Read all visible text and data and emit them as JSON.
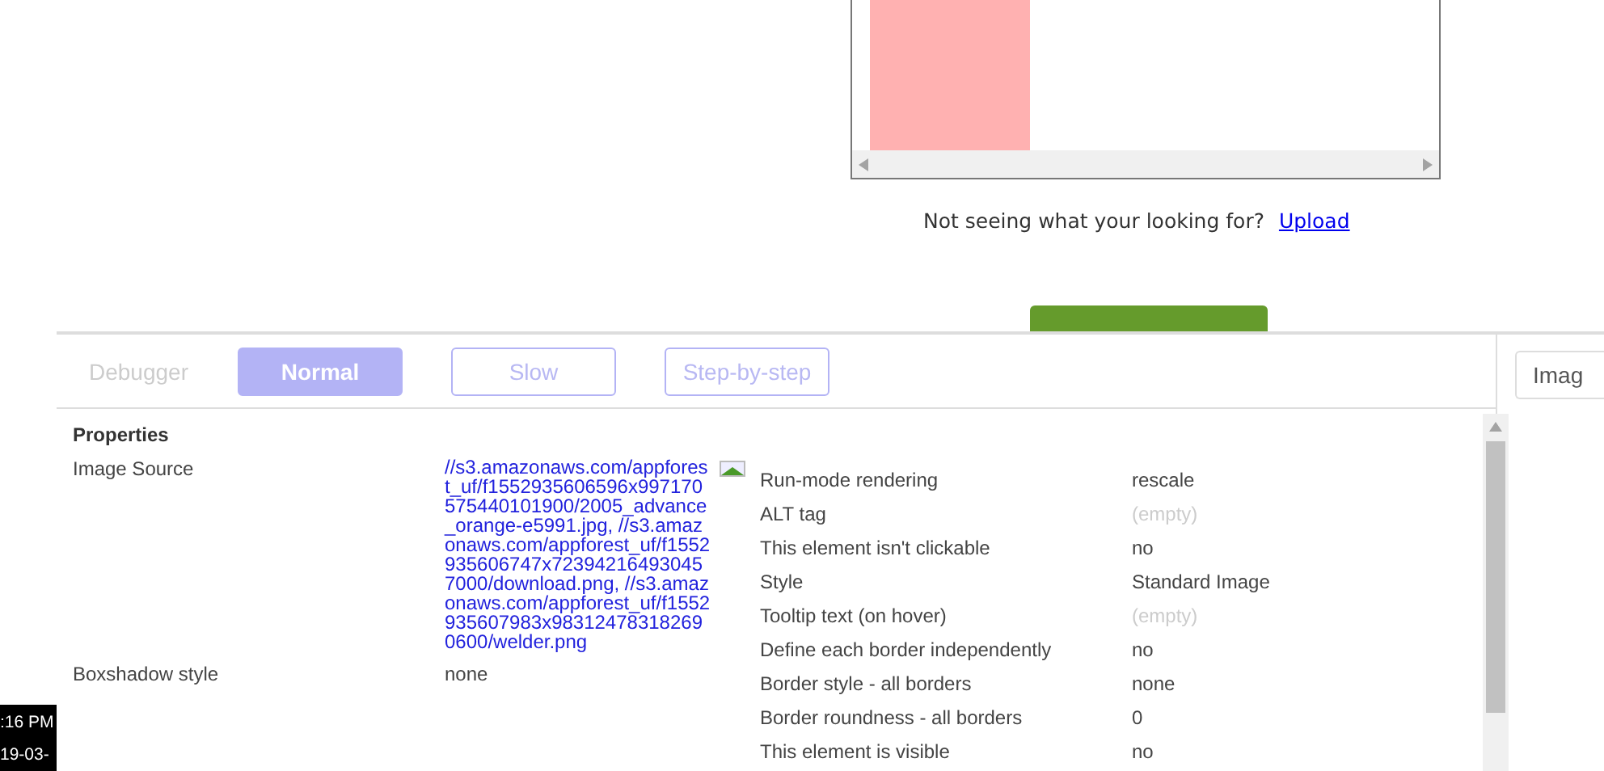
{
  "preview": {
    "prompt": "Not seeing what your looking for?",
    "upload_link": "Upload"
  },
  "toolbar": {
    "label": "Debugger",
    "modes": [
      {
        "label": "Normal",
        "selected": true
      },
      {
        "label": "Slow",
        "selected": false
      },
      {
        "label": "Step-by-step",
        "selected": false
      }
    ]
  },
  "side_panel": {
    "field_value": "Imag"
  },
  "properties": {
    "title": "Properties",
    "left": [
      {
        "label": "Image Source",
        "kind": "link",
        "value": "//s3.amazonaws.com/appforest_uf/f1552935606596x997170575440101900/2005_advance_orange-e5991.jpg, //s3.amazonaws.com/appforest_uf/f1552935606747x723942164930457000/download.png, //s3.amazonaws.com/appforest_uf/f1552935607983x983124783182690600/welder.png"
      },
      {
        "label": "Boxshadow style",
        "kind": "text",
        "value": "none"
      }
    ],
    "right": [
      {
        "label": "Run-mode rendering",
        "kind": "text",
        "value": "rescale"
      },
      {
        "label": "ALT tag",
        "kind": "empty",
        "value": "(empty)"
      },
      {
        "label": "This element isn't clickable",
        "kind": "text",
        "value": "no"
      },
      {
        "label": "Style",
        "kind": "text",
        "value": "Standard Image"
      },
      {
        "label": "Tooltip text (on hover)",
        "kind": "empty",
        "value": "(empty)"
      },
      {
        "label": "Define each border independently",
        "kind": "text",
        "value": "no"
      },
      {
        "label": "Border style - all borders",
        "kind": "text",
        "value": "none"
      },
      {
        "label": "Border roundness - all borders",
        "kind": "text",
        "value": "0"
      },
      {
        "label": "This element is visible",
        "kind": "text",
        "value": "no"
      }
    ]
  },
  "taskbar": {
    "time": ":16 PM",
    "date": "19-03-"
  }
}
